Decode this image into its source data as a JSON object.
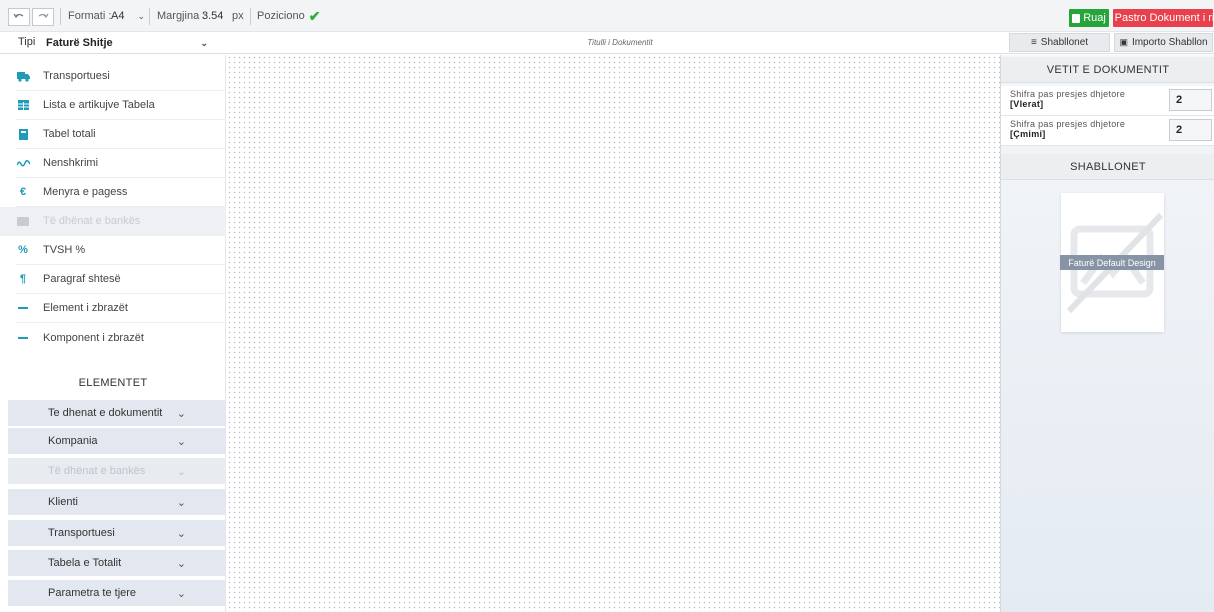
{
  "toolbar": {
    "undo_icon": "undo-icon",
    "redo_icon": "redo-icon",
    "format_label": "Formati :",
    "format_value": "A4",
    "margin_label": "Margjina :",
    "margin_value": "3.54",
    "margin_unit": "px",
    "position_label": "Poziciono",
    "save_label": "Ruaj",
    "clear_label": "Pastro Dokument i ri",
    "save_color": "#27a53a",
    "clear_color": "#e8404c"
  },
  "secondbar": {
    "type_label": "Tipi",
    "type_value": "Faturë Shitje",
    "doc_title": "Titulli i Dokumentit",
    "templates_button": "Shabllonet",
    "import_button": "Importo Shabllon"
  },
  "components": [
    {
      "label": "Transportuesi",
      "icon": "truck-icon",
      "disabled": false
    },
    {
      "label": "Lista e artikujve Tabela",
      "icon": "table-icon",
      "disabled": false
    },
    {
      "label": "Tabel totali",
      "icon": "calculator-icon",
      "disabled": false
    },
    {
      "label": "Nenshkrimi",
      "icon": "signature-icon",
      "disabled": false
    },
    {
      "label": "Menyra e pagess",
      "icon": "euro-icon",
      "disabled": false
    },
    {
      "label": "Të dhënat e bankës",
      "icon": "card-icon",
      "disabled": true
    },
    {
      "label": "TVSH %",
      "icon": "percent-icon",
      "disabled": false
    },
    {
      "label": "Paragraf shtesë",
      "icon": "paragraph-icon",
      "disabled": false
    },
    {
      "label": "Element i zbrazët",
      "icon": "minus-icon",
      "disabled": false
    },
    {
      "label": "Komponent i zbrazët",
      "icon": "minus-icon",
      "disabled": false
    }
  ],
  "elements": {
    "heading": "ELEMENTET",
    "groups": [
      {
        "label": "Te dhenat e dokumentit",
        "disabled": false
      },
      {
        "label": "Kompania",
        "disabled": false
      },
      {
        "label": "Të dhënat e bankës",
        "disabled": true
      },
      {
        "label": "Klienti",
        "disabled": false
      },
      {
        "label": "Transportuesi",
        "disabled": false
      },
      {
        "label": "Tabela e Totalit",
        "disabled": false
      },
      {
        "label": "Parametra te tjere",
        "disabled": false
      }
    ]
  },
  "properties": {
    "heading": "VETIT E DOKUMENTIT",
    "rows": [
      {
        "label": "Shifra pas presjes dhjetore",
        "sub": "[Vlerat]",
        "value": "2"
      },
      {
        "label": "Shifra pas presjes dhjetore",
        "sub": "[Çmimi]",
        "value": "2"
      }
    ]
  },
  "templates": {
    "heading": "SHABLLONET",
    "items": [
      {
        "name": "Faturë Default Design"
      }
    ]
  }
}
